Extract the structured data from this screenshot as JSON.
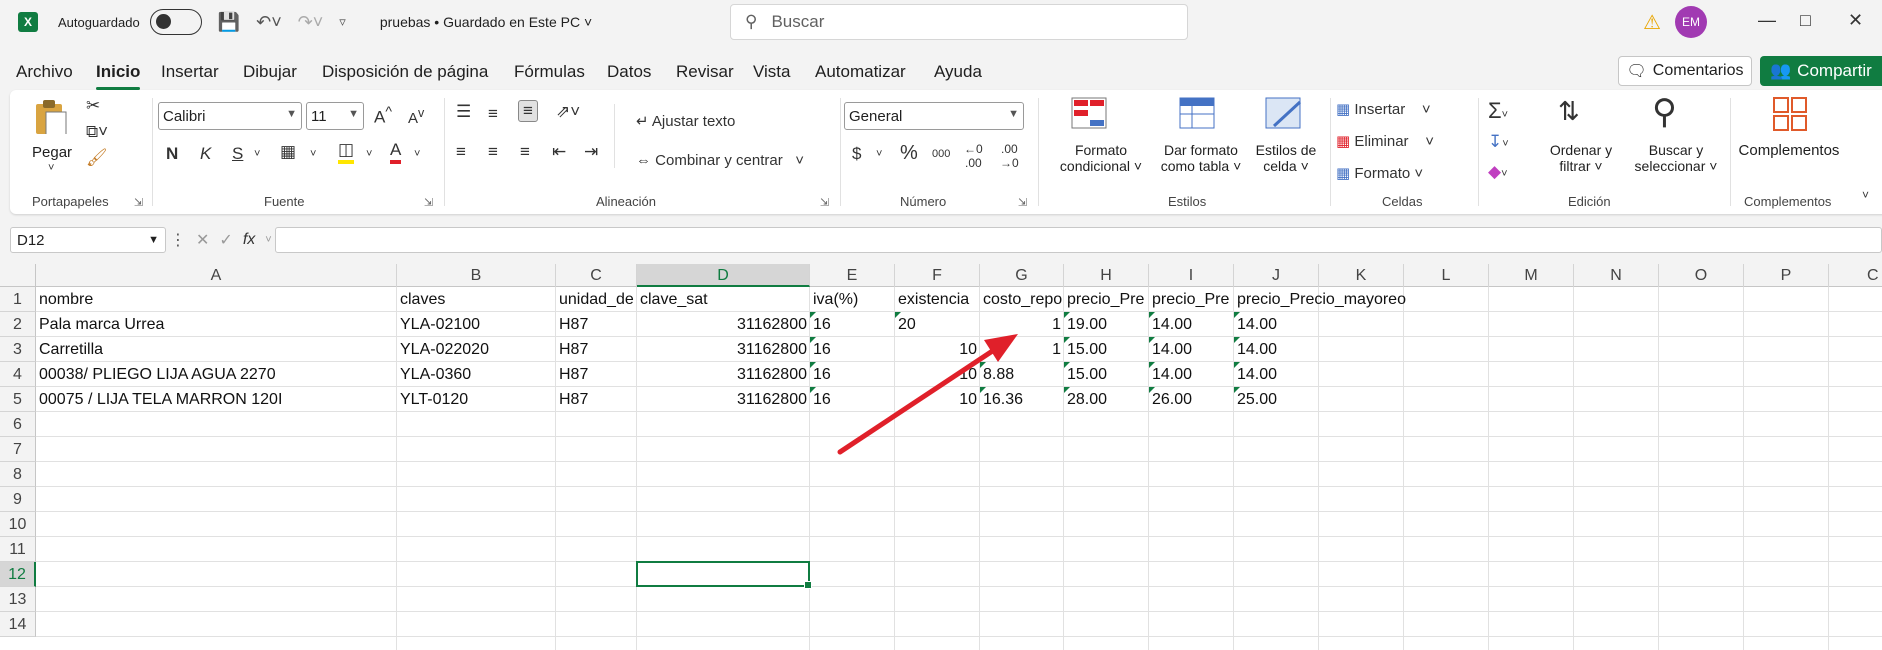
{
  "titlebar": {
    "autosave_label": "Autoguardado",
    "doc_title": "pruebas • Guardado en Este PC",
    "search_placeholder": "Buscar",
    "avatar_initials": "EM"
  },
  "menu": {
    "tabs": [
      "Archivo",
      "Inicio",
      "Insertar",
      "Dibujar",
      "Disposición de página",
      "Fórmulas",
      "Datos",
      "Revisar",
      "Vista",
      "Automatizar",
      "Ayuda"
    ],
    "comments_label": "Comentarios",
    "share_label": "Compartir"
  },
  "ribbon": {
    "clipboard": {
      "paste_label": "Pegar",
      "group_label": "Portapapeles"
    },
    "font": {
      "font_name": "Calibri",
      "font_size": "11",
      "bold": "N",
      "italic": "K",
      "underline": "S",
      "group_label": "Fuente"
    },
    "alignment": {
      "wrap_text": "Ajustar texto",
      "merge_center": "Combinar y centrar",
      "group_label": "Alineación"
    },
    "number": {
      "format": "General",
      "currency": "$",
      "percent": "%",
      "thousands": "000",
      "group_label": "Número"
    },
    "styles": {
      "conditional_1": "Formato",
      "conditional_2": "condicional",
      "table_1": "Dar formato",
      "table_2": "como tabla",
      "cell_1": "Estilos de",
      "cell_2": "celda",
      "group_label": "Estilos"
    },
    "cells": {
      "insert": "Insertar",
      "delete": "Eliminar",
      "format": "Formato",
      "group_label": "Celdas"
    },
    "editing": {
      "sort_1": "Ordenar y",
      "sort_2": "filtrar",
      "find_1": "Buscar y",
      "find_2": "seleccionar",
      "group_label": "Edición"
    },
    "addins": {
      "label": "Complementos",
      "group_label": "Complementos"
    }
  },
  "formula_bar": {
    "name_box": "D12",
    "fx": "fx",
    "value": ""
  },
  "sheet": {
    "columns": [
      "A",
      "B",
      "C",
      "D",
      "E",
      "F",
      "G",
      "H",
      "I",
      "J",
      "K",
      "L",
      "M",
      "N",
      "O",
      "P"
    ],
    "last_col_partial": "C",
    "rows": [
      "1",
      "2",
      "3",
      "4",
      "5",
      "6",
      "7",
      "8",
      "9",
      "10",
      "11",
      "12",
      "13",
      "14"
    ],
    "selected_cell": "D12",
    "data": [
      [
        "nombre",
        "claves",
        "unidad_de",
        "clave_sat",
        "iva(%)",
        "existencia",
        "costo_repo",
        "precio_Pre",
        "precio_Pre",
        "precio_Precio_mayoreo"
      ],
      [
        "Pala marca Urrea",
        "YLA-02100",
        "H87",
        "31162800",
        "16",
        "20",
        "1",
        "19.00",
        "14.00",
        "14.00"
      ],
      [
        "Carretilla",
        "YLA-022020",
        "H87",
        "31162800",
        "16",
        "10",
        "1",
        "15.00",
        "14.00",
        "14.00"
      ],
      [
        "00038/  PLIEGO LIJA AGUA 2270",
        "YLA-0360",
        "H87",
        "31162800",
        "16",
        "10",
        "8.88",
        "15.00",
        "14.00",
        "14.00"
      ],
      [
        "00075 / LIJA TELA MARRON 120I",
        "YLT-0120",
        "H87",
        "31162800",
        "16",
        "10",
        "16.36",
        "28.00",
        "26.00",
        "25.00"
      ]
    ]
  },
  "colors": {
    "accent": "#107c41",
    "arrow": "#e0202a",
    "avatar": "#a13ab2"
  }
}
